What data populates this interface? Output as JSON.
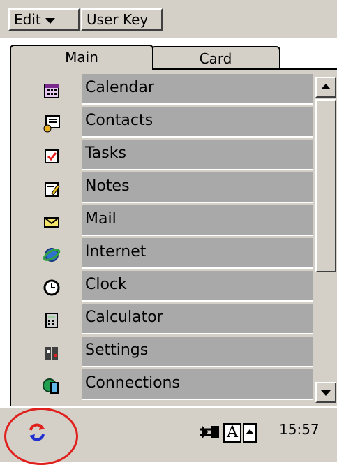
{
  "menubar": {
    "edit_label": "Edit",
    "userkey_label": "User Key"
  },
  "tabs": [
    {
      "label": "Main"
    },
    {
      "label": "Card"
    }
  ],
  "apps": [
    {
      "label": "Calendar",
      "icon": "calendar-icon"
    },
    {
      "label": "Contacts",
      "icon": "contacts-icon"
    },
    {
      "label": "Tasks",
      "icon": "tasks-icon"
    },
    {
      "label": "Notes",
      "icon": "notes-icon"
    },
    {
      "label": "Mail",
      "icon": "mail-icon"
    },
    {
      "label": "Internet",
      "icon": "internet-icon"
    },
    {
      "label": "Clock",
      "icon": "clock-icon"
    },
    {
      "label": "Calculator",
      "icon": "calculator-icon"
    },
    {
      "label": "Settings",
      "icon": "settings-icon"
    },
    {
      "label": "Connections",
      "icon": "connections-icon"
    }
  ],
  "taskbar": {
    "time": "15:57",
    "input_label": "A"
  },
  "colors": {
    "highlight_circle": "#e0201c",
    "row_bg": "#a9a9a9",
    "chrome": "#d4d0c8"
  }
}
